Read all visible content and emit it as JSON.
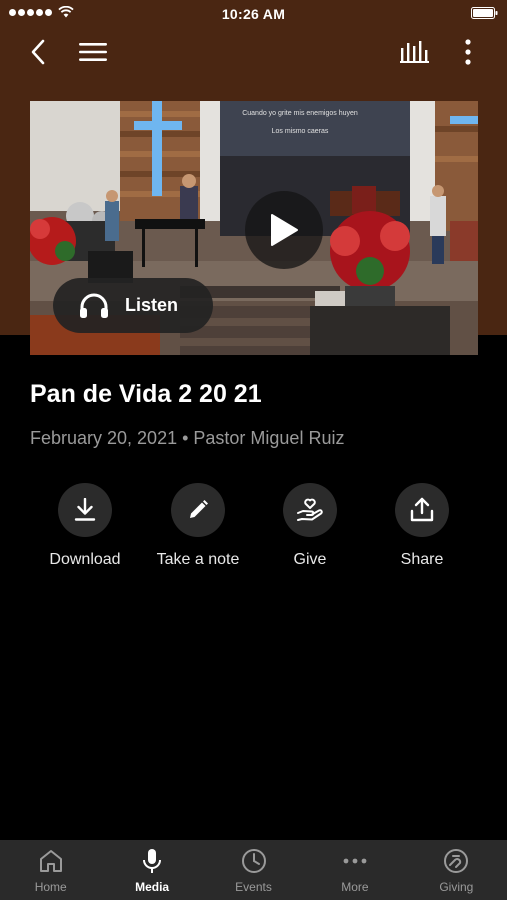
{
  "status_bar": {
    "time": "10:26 AM"
  },
  "nav": {
    "back_icon": "chevron-left-icon",
    "menu_icon": "hamburger-menu-icon",
    "audio_icon": "equalizer-icon",
    "more_icon": "vertical-ellipsis-icon"
  },
  "media": {
    "listen_label": "Listen",
    "play_icon": "play-icon",
    "listen_icon": "headphones-icon",
    "slide_text_line1": "Cuando yo grite mis enemigos huyen",
    "slide_text_line2": "Los mismo caeras"
  },
  "sermon": {
    "title": "Pan de Vida 2 20 21",
    "meta": "February 20, 2021 • Pastor Miguel Ruiz"
  },
  "actions": [
    {
      "label": "Download",
      "icon": "download-icon"
    },
    {
      "label": "Take a note",
      "icon": "pencil-icon"
    },
    {
      "label": "Give",
      "icon": "heart-hand-icon"
    },
    {
      "label": "Share",
      "icon": "share-icon"
    }
  ],
  "tabs": [
    {
      "label": "Home",
      "icon": "home-icon",
      "active": false
    },
    {
      "label": "Media",
      "icon": "microphone-icon",
      "active": true
    },
    {
      "label": "Events",
      "icon": "clock-icon",
      "active": false
    },
    {
      "label": "More",
      "icon": "ellipsis-icon",
      "active": false
    },
    {
      "label": "Giving",
      "icon": "giving-icon",
      "active": false
    }
  ],
  "colors": {
    "header_brown": "#4a2612",
    "background": "#000000",
    "tab_bar": "#2a2a2a",
    "action_circle": "#2b2b2b",
    "meta_gray": "#9a9a9a"
  }
}
